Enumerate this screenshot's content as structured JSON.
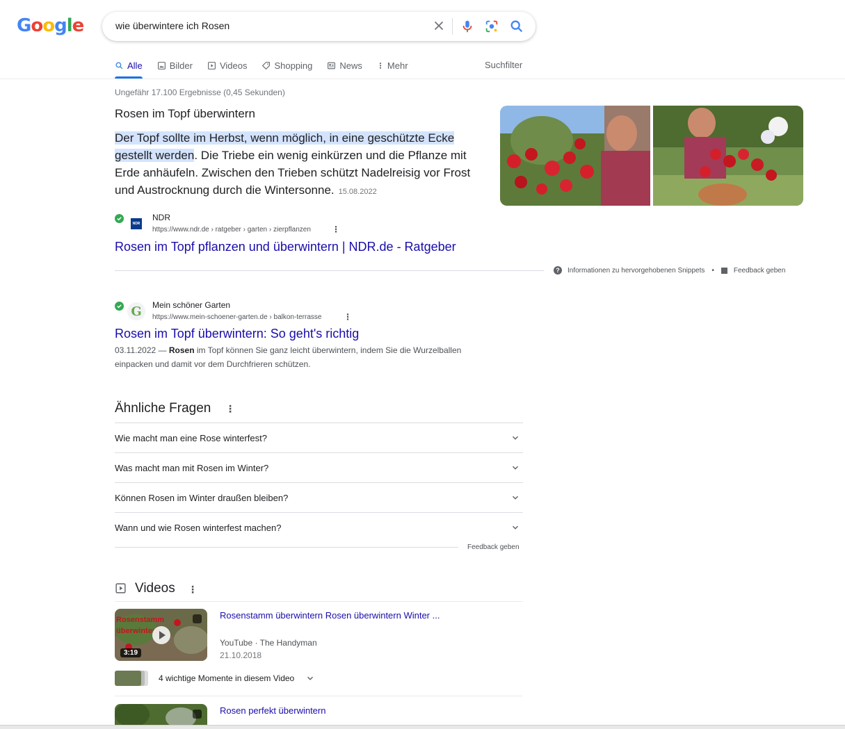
{
  "logo": "Google",
  "search": {
    "query": "wie überwintere ich Rosen"
  },
  "tabs": [
    {
      "label": "Alle",
      "icon": "search-icon",
      "active": true
    },
    {
      "label": "Bilder",
      "icon": "image-icon"
    },
    {
      "label": "Videos",
      "icon": "play-icon"
    },
    {
      "label": "Shopping",
      "icon": "tag-icon"
    },
    {
      "label": "News",
      "icon": "news-icon"
    },
    {
      "label": "Mehr",
      "icon": "more-vertical-icon"
    }
  ],
  "suchfilter": "Suchfilter",
  "stats": "Ungefähr 17.100 Ergebnisse (0,45 Sekunden)",
  "featured": {
    "heading": "Rosen im Topf überwintern",
    "highlight": "Der Topf sollte im Herbst, wenn möglich, in eine geschützte Ecke gestellt werden",
    "rest": ". Die Triebe ein wenig einkürzen und die Pflanze mit Erde anhäufeln. Zwischen den Trieben schützt Nadelreisig vor Frost und Austrocknung durch die Wintersonne.",
    "date": "15.08.2022",
    "site_name": "NDR",
    "url": "https://www.ndr.de › ratgeber › garten › zierpflanzen",
    "title": "Rosen im Topf pflanzen und überwintern | NDR.de - Ratgeber",
    "favicon_text": "NDR",
    "info": "Informationen zu hervorgehobenen Snippets",
    "feedback": "Feedback geben"
  },
  "result2": {
    "site_name": "Mein schöner Garten",
    "favicon_text": "G",
    "url": "https://www.mein-schoener-garten.de › balkon-terrasse",
    "title": "Rosen im Topf überwintern: So geht's richtig",
    "date": "03.11.2022 —",
    "snippet_bold": "Rosen",
    "snippet_rest": " im Topf können Sie ganz leicht überwintern, indem Sie die Wurzelballen einpacken und damit vor dem Durchfrieren schützen."
  },
  "related": {
    "title": "Ähnliche Fragen",
    "questions": [
      "Wie macht man eine Rose winterfest?",
      "Was macht man mit Rosen im Winter?",
      "Können Rosen im Winter draußen bleiben?",
      "Wann und wie Rosen winterfest machen?"
    ],
    "feedback": "Feedback geben"
  },
  "videos": {
    "title": "Videos",
    "items": [
      {
        "title": "Rosenstamm überwintern Rosen überwintern Winter ...",
        "source": "YouTube",
        "channel": "The Handyman",
        "separator": " · ",
        "date": "21.10.2018",
        "duration": "3:19",
        "overlay_text": "Rosenstamm überwintern"
      },
      {
        "title": "Rosen perfekt überwintern"
      }
    ],
    "moments": "4 wichtige Momente in diesem Video"
  }
}
